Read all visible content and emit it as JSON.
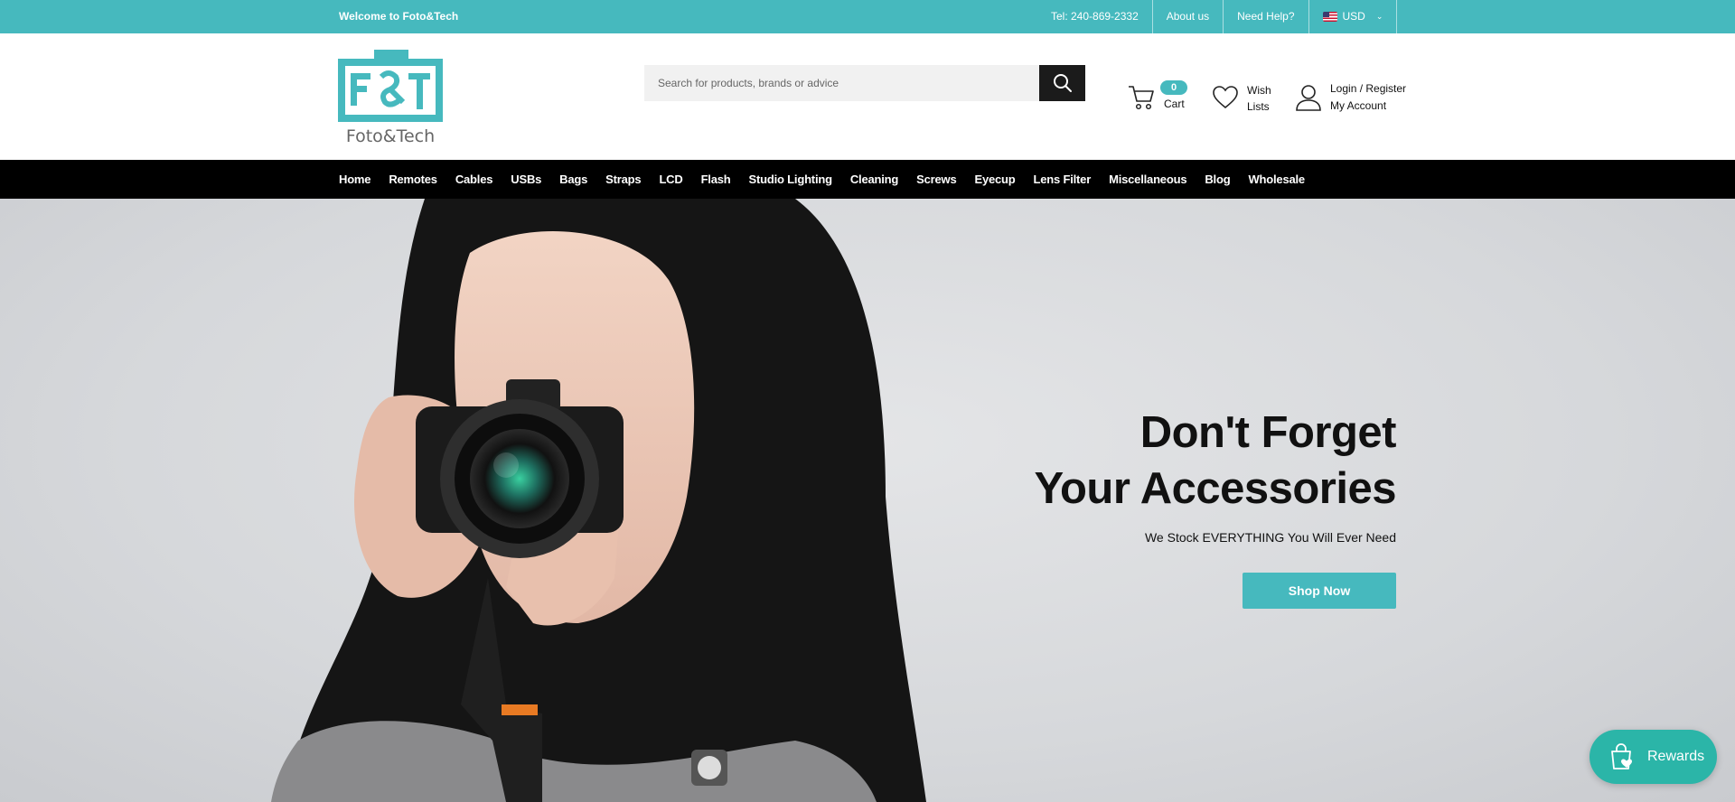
{
  "topbar": {
    "welcome": "Welcome to Foto&Tech",
    "phone": "Tel: 240-869-2332",
    "about": "About us",
    "help": "Need Help?",
    "currency": "USD"
  },
  "header": {
    "logo_text": "Foto&Tech",
    "search_placeholder": "Search for products, brands or advice",
    "cart_count": "0",
    "cart_label": "Cart",
    "wish_label": "Wish Lists",
    "account_line1": "Login / Register",
    "account_line2": "My Account"
  },
  "nav": {
    "items": [
      "Home",
      "Remotes",
      "Cables",
      "USBs",
      "Bags",
      "Straps",
      "LCD",
      "Flash",
      "Studio Lighting",
      "Cleaning",
      "Screws",
      "Eyecup",
      "Lens Filter",
      "Miscellaneous",
      "Blog",
      "Wholesale"
    ]
  },
  "hero": {
    "title_line1": "Don't Forget",
    "title_line2": "Your Accessories",
    "subtitle": "We Stock EVERYTHING You Will Ever Need",
    "cta": "Shop Now"
  },
  "rewards": {
    "label": "Rewards"
  },
  "colors": {
    "accent": "#46b9be",
    "nav_bg": "#000000",
    "rewards": "#2bb5a8"
  }
}
